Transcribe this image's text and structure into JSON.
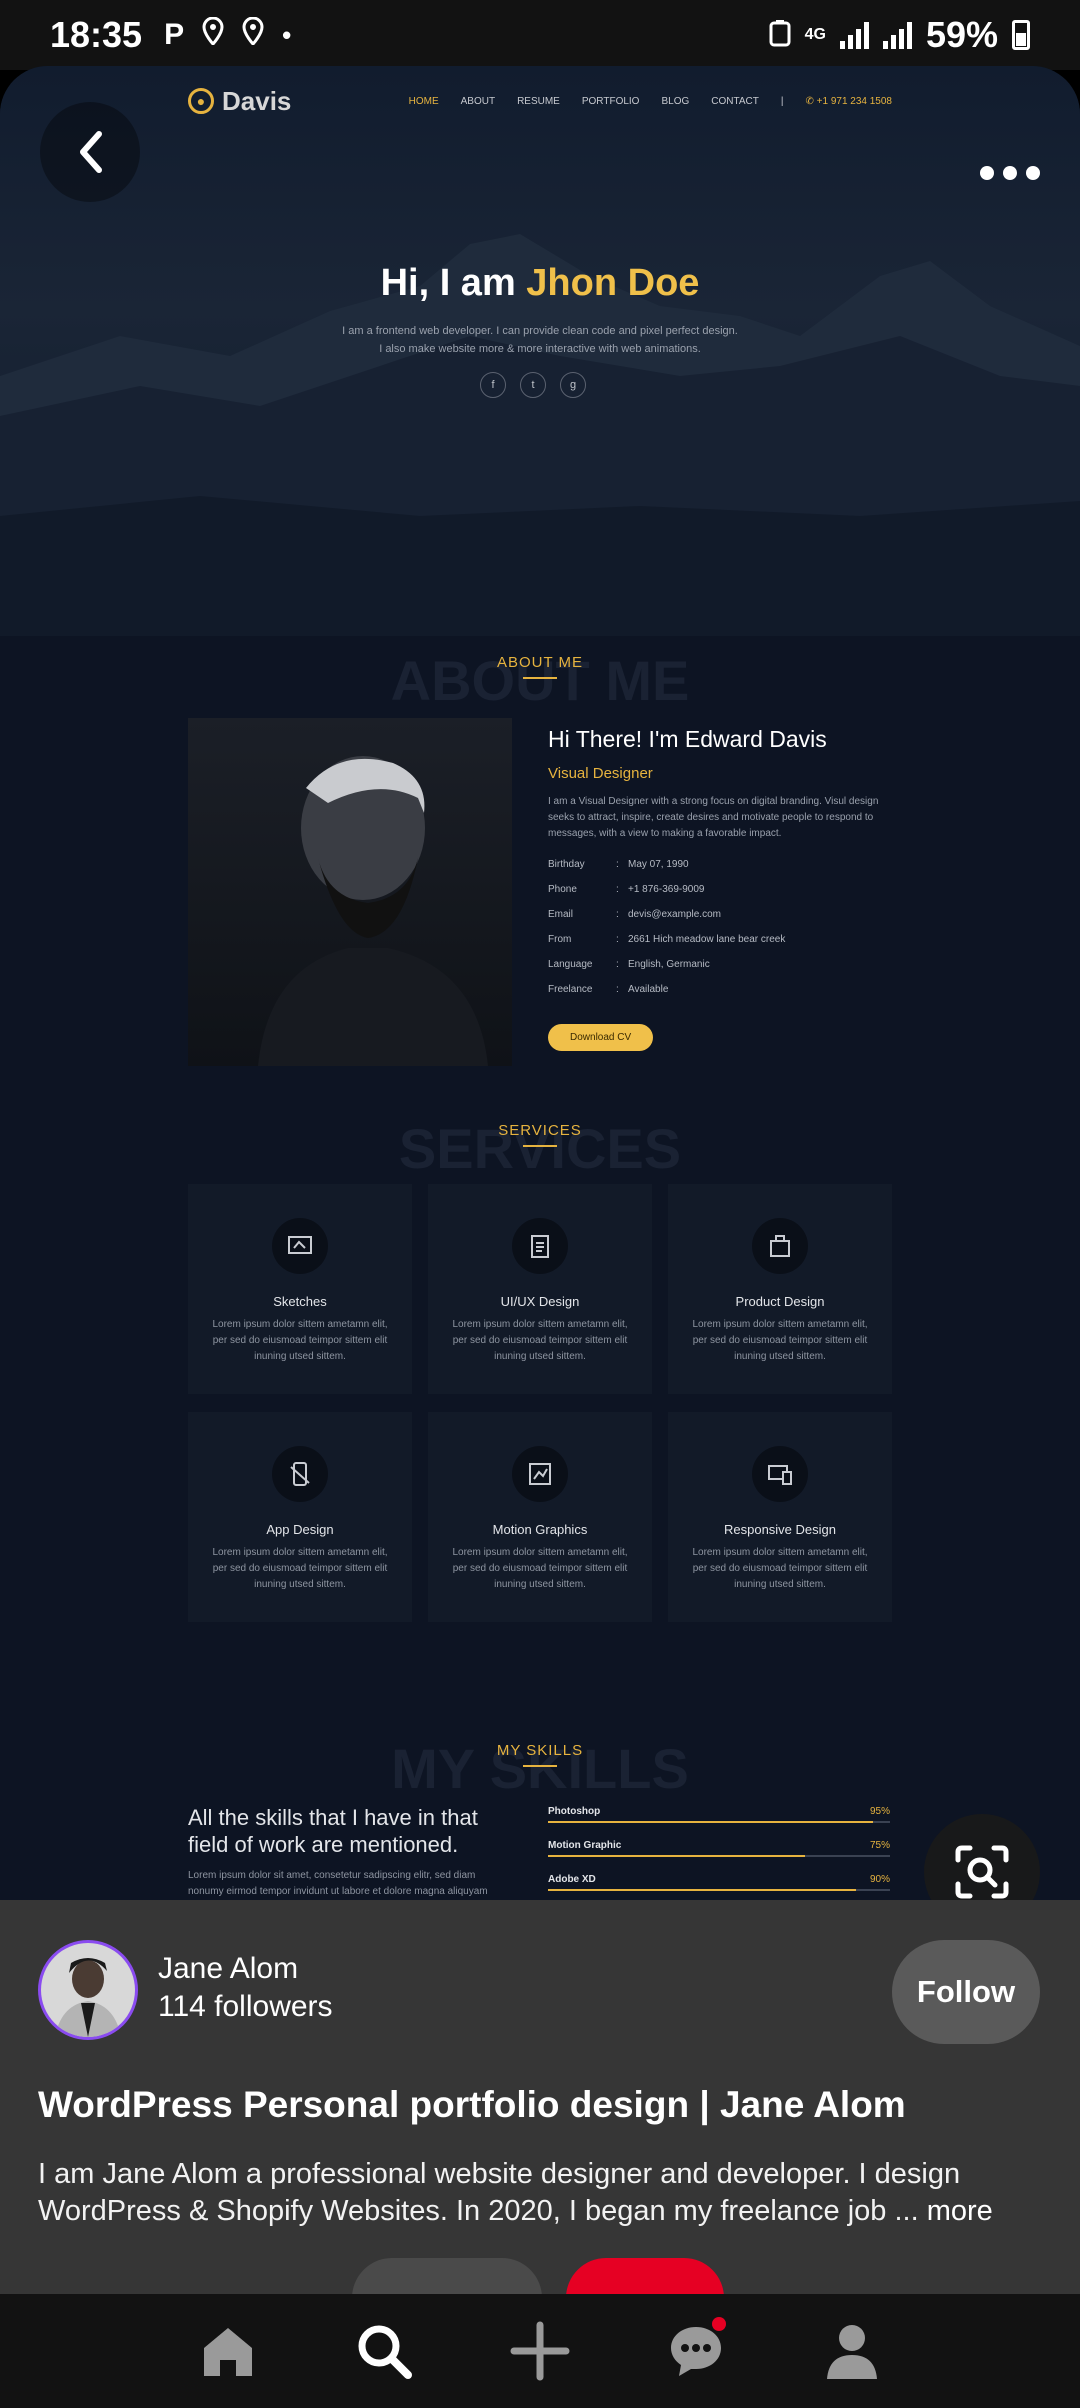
{
  "status_bar": {
    "time": "18:35",
    "left_icons": [
      "parking-icon",
      "location-icon",
      "location-icon",
      "dot-icon"
    ],
    "network": "4G",
    "battery": "59%"
  },
  "pin_image": {
    "site_nav": {
      "logo": "Davis",
      "links": [
        "HOME",
        "ABOUT",
        "RESUME",
        "PORTFOLIO",
        "BLOG",
        "CONTACT"
      ],
      "separator": "|",
      "phone": "+1 971 234 1508"
    },
    "hero": {
      "title_prefix": "Hi, I am ",
      "title_highlight": "Jhon Doe",
      "subtitle_line1": "I am a frontend web developer. I can provide clean code and pixel perfect design.",
      "subtitle_line2": "I also make website more & more interactive with web animations.",
      "social": [
        "f",
        "t",
        "g"
      ]
    },
    "about": {
      "ghost": "ABOUT ME",
      "label": "ABOUT ME",
      "greeting": "Hi There! I'm Edward Davis",
      "role": "Visual Designer",
      "description": "I am a Visual Designer with a strong focus on digital branding. Visul design seeks to attract, inspire, create desires and motivate people to respond to messages, with a view to making a favorable impact.",
      "facts": [
        {
          "key": "Birthday",
          "value": "May 07, 1990"
        },
        {
          "key": "Phone",
          "value": "+1 876-369-9009"
        },
        {
          "key": "Email",
          "value": "devis@example.com"
        },
        {
          "key": "From",
          "value": "2661 Hich meadow lane bear creek"
        },
        {
          "key": "Language",
          "value": "English, Germanic"
        },
        {
          "key": "Freelance",
          "value": "Available"
        }
      ],
      "fact_separator": ":",
      "cv_button": "Download CV"
    },
    "services": {
      "ghost": "SERVICES",
      "label": "SERVICES",
      "items": [
        {
          "title": "Sketches",
          "desc": "Lorem ipsum dolor sittem ametamn elit, per sed do eiusmoad teimpor sittem elit inuning utsed sittem."
        },
        {
          "title": "UI/UX Design",
          "desc": "Lorem ipsum dolor sittem ametamn elit, per sed do eiusmoad teimpor sittem elit inuning utsed sittem."
        },
        {
          "title": "Product Design",
          "desc": "Lorem ipsum dolor sittem ametamn elit, per sed do eiusmoad teimpor sittem elit inuning utsed sittem."
        },
        {
          "title": "App Design",
          "desc": "Lorem ipsum dolor sittem ametamn elit, per sed do eiusmoad teimpor sittem elit inuning utsed sittem."
        },
        {
          "title": "Motion Graphics",
          "desc": "Lorem ipsum dolor sittem ametamn elit, per sed do eiusmoad teimpor sittem elit inuning utsed sittem."
        },
        {
          "title": "Responsive Design",
          "desc": "Lorem ipsum dolor sittem ametamn elit, per sed do eiusmoad teimpor sittem elit inuning utsed sittem."
        }
      ]
    },
    "skills": {
      "ghost": "MY SKILLS",
      "label": "MY SKILLS",
      "heading": "All the skills that I have in that field of work are mentioned.",
      "paragraph": "Lorem ipsum dolor sit amet, consetetur sadipscing elitr, sed diam nonumy eirmod tempor invidunt ut labore et dolore magna aliquyam",
      "items": [
        {
          "name": "Photoshop",
          "pct": "95%",
          "level": 95
        },
        {
          "name": "Motion Graphic",
          "pct": "75%",
          "level": 75
        },
        {
          "name": "Adobe XD",
          "pct": "90%",
          "level": 90
        }
      ]
    }
  },
  "overlay_buttons": {
    "back_icon": "chevron-left-icon",
    "more_icon": "more-horizontal-icon",
    "lens_icon": "visual-search-icon"
  },
  "pin_info": {
    "author_name": "Jane Alom",
    "followers": "114 followers",
    "follow_label": "Follow",
    "title": "WordPress Personal portfolio design | Jane Alom",
    "description": "I am Jane Alom a professional website designer and developer. I design WordPress & Shopify Websites. In 2020, I began my freelance job ...",
    "more_label": "more"
  },
  "bottom_nav": {
    "items": [
      "home-icon",
      "search-icon",
      "create-icon",
      "messages-icon",
      "profile-icon"
    ]
  },
  "colors": {
    "accent": "#e6b33f",
    "pinterest_red": "#e60023",
    "sheet_bg": "#363636"
  }
}
